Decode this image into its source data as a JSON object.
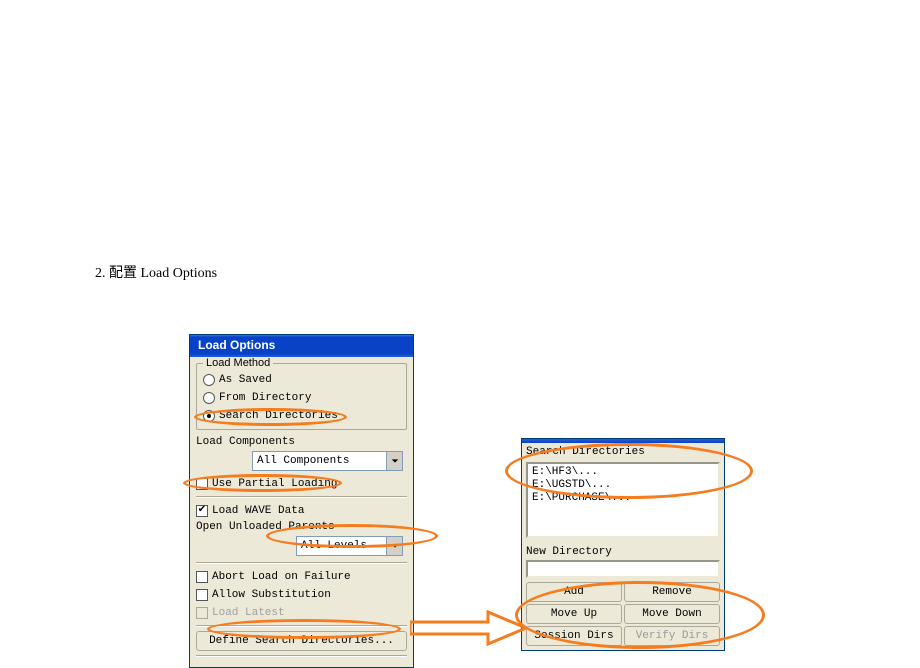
{
  "heading": "2. 配置 Load Options",
  "dlg1": {
    "title": "Load Options",
    "group_label": "Load Method",
    "radios": [
      "As Saved",
      "From Directory",
      "Search Directories"
    ],
    "radio_selected": 2,
    "load_components_label": "Load Components",
    "combo1": "All Components",
    "use_partial_label": "Use Partial Loading",
    "load_wave_label": "Load WAVE Data",
    "open_unloaded_label": "Open Unloaded Parents",
    "combo2": "All Levels",
    "abort_label": "Abort Load on Failure",
    "allow_sub_label": "Allow Substitution",
    "load_latest_label": "Load Latest",
    "define_btn": "Define Search Directories..."
  },
  "dlg2": {
    "title": "Search Directories",
    "list_items": [
      "E:\\HF3\\...",
      "E:\\UGSTD\\...",
      "E:\\PURCHASE\\..."
    ],
    "new_dir_label": "New Directory",
    "buttons": [
      "Add",
      "Remove",
      "Move Up",
      "Move Down",
      "Session Dirs",
      "Verify Dirs"
    ]
  }
}
